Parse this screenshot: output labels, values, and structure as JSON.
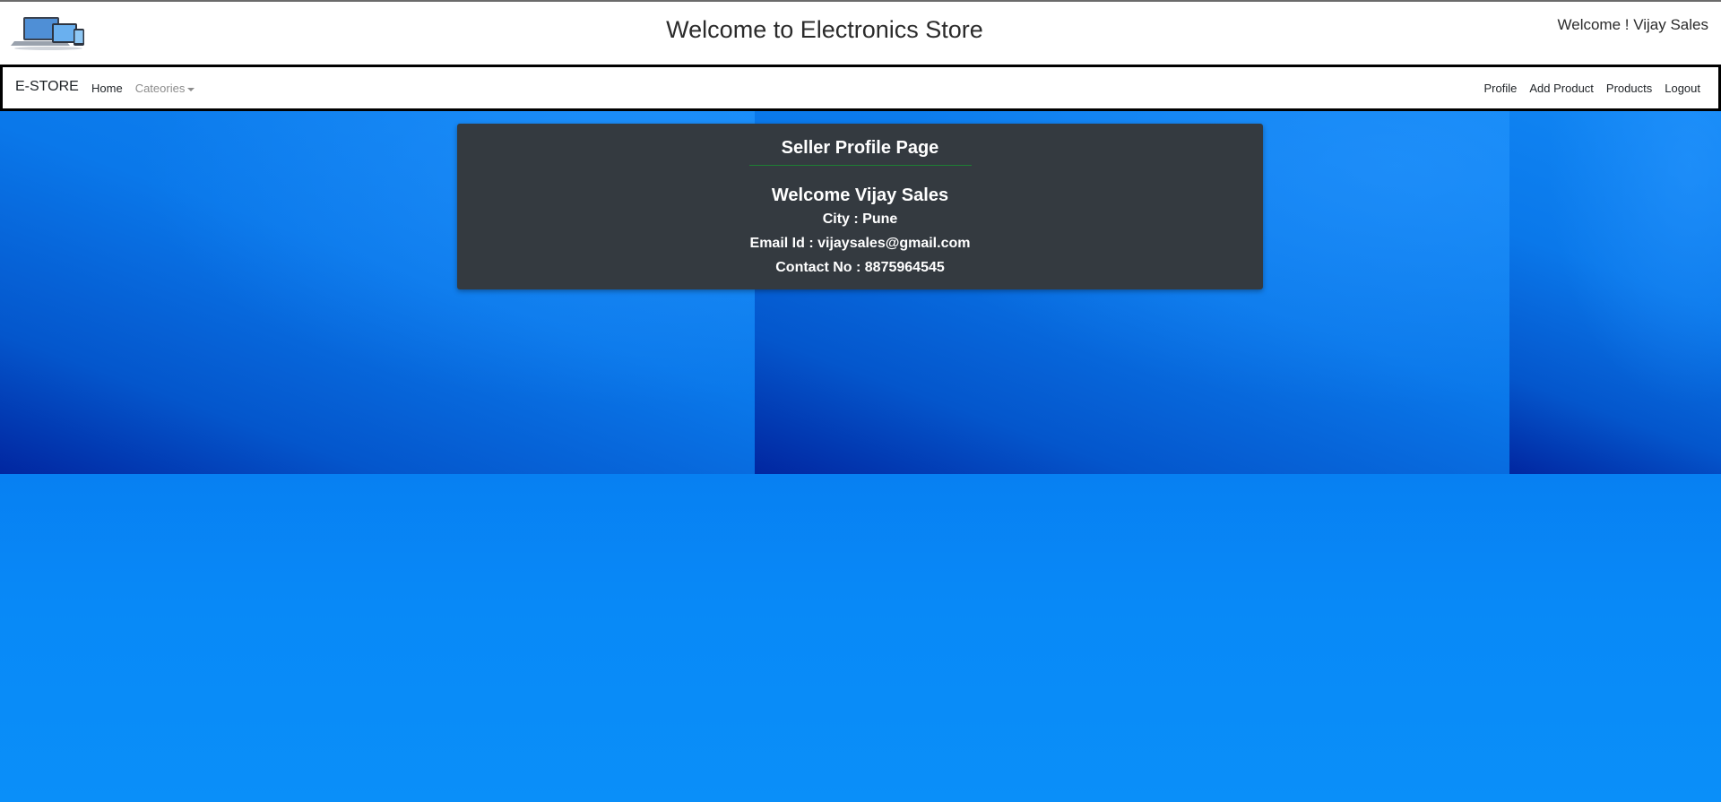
{
  "header": {
    "title": "Welcome to Electronics Store",
    "welcome_user": "Welcome ! Vijay Sales",
    "logo_icon": "devices-logo-icon"
  },
  "navbar": {
    "brand": "E-STORE",
    "left_links": [
      "Home",
      "Cateories"
    ],
    "right_links": [
      "Profile",
      "Add Product",
      "Products",
      "Logout"
    ]
  },
  "card": {
    "title": "Seller Profile Page",
    "welcome": "Welcome Vijay Sales",
    "city_line": "City : Pune",
    "email_line": "Email Id : vijaysales@gmail.com",
    "contact_line": "Contact No : 8875964545"
  },
  "colors": {
    "card_bg": "#343a40",
    "divider": "#1e7e34",
    "background_blue": "#0a80f2"
  }
}
